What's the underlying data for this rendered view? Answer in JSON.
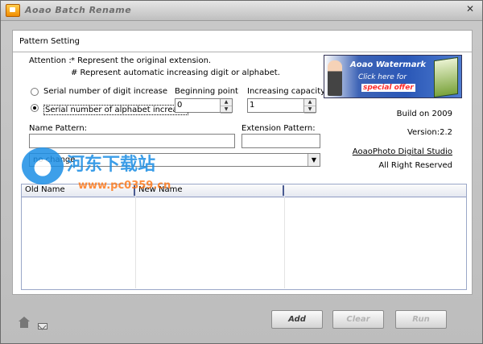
{
  "window": {
    "title": "Aoao Batch Rename",
    "close_label": "✕"
  },
  "pattern_setting": {
    "title": "Pattern Setting",
    "attention_label": "Attention :",
    "attention_line1": "* Represent the original extension.",
    "attention_line2": "# Represent automatic increasing digit or alphabet.",
    "radio_digit": "Serial number of digit increase",
    "radio_alpha": "Serial number of alphabet increase",
    "beginning_point_label": "Beginning point",
    "beginning_point_value": "0",
    "increasing_capacity_label": "Increasing capacity",
    "increasing_capacity_value": "1",
    "name_pattern_label": "Name Pattern:",
    "name_pattern_value": "",
    "extension_pattern_label": "Extension Pattern:",
    "extension_pattern_value": "",
    "case_select_value": "no change"
  },
  "ad": {
    "title": "Aoao Watermark",
    "subtitle": "Click here for",
    "offer": "special offer"
  },
  "info": {
    "build": "Build on 2009",
    "version": "Version:2.2",
    "studio_link": "AoaoPhoto Digital Studio",
    "rights": "All Right Reserved"
  },
  "table": {
    "columns": [
      "Old Name",
      "New Name",
      ""
    ]
  },
  "buttons": {
    "add": "Add",
    "clear": "Clear",
    "run": "Run"
  },
  "watermark": {
    "cn_text": "河东下载站",
    "url": "www.pc0359.cn"
  }
}
